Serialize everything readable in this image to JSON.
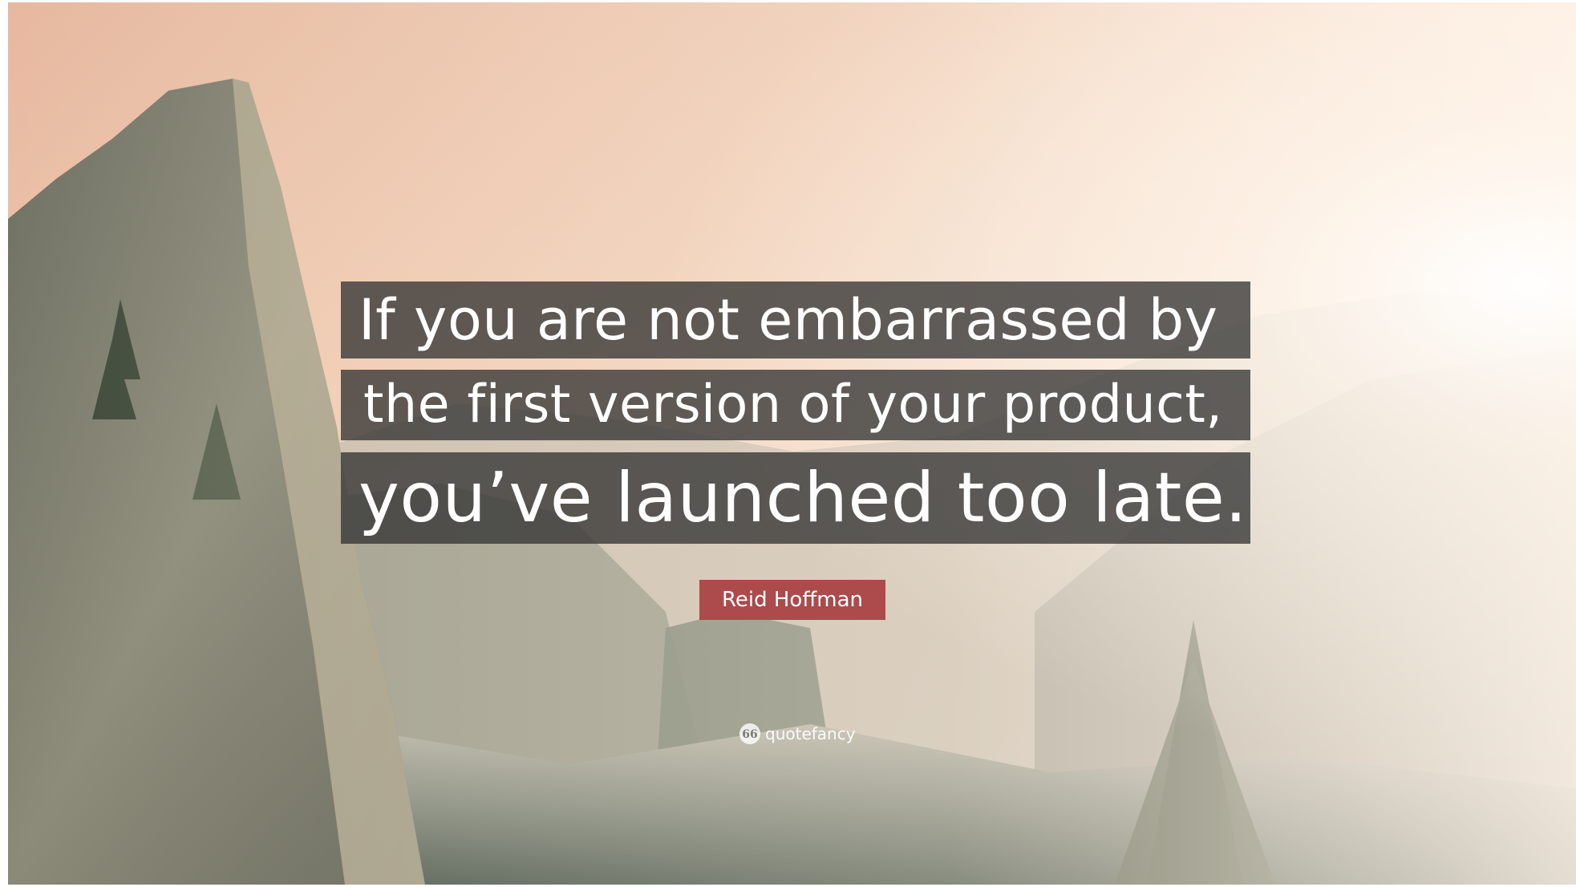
{
  "quote": {
    "lines": [
      "If you are not embarrassed by",
      "the first version of your product,",
      "you’ve launched too late."
    ],
    "author": "Reid Hoffman"
  },
  "watermark": {
    "icon": "quote-marks-icon",
    "icon_glyph": "66",
    "text": "quotefancy"
  },
  "colors": {
    "author_badge": "#ad4a4c",
    "quote_box": "#343434"
  }
}
